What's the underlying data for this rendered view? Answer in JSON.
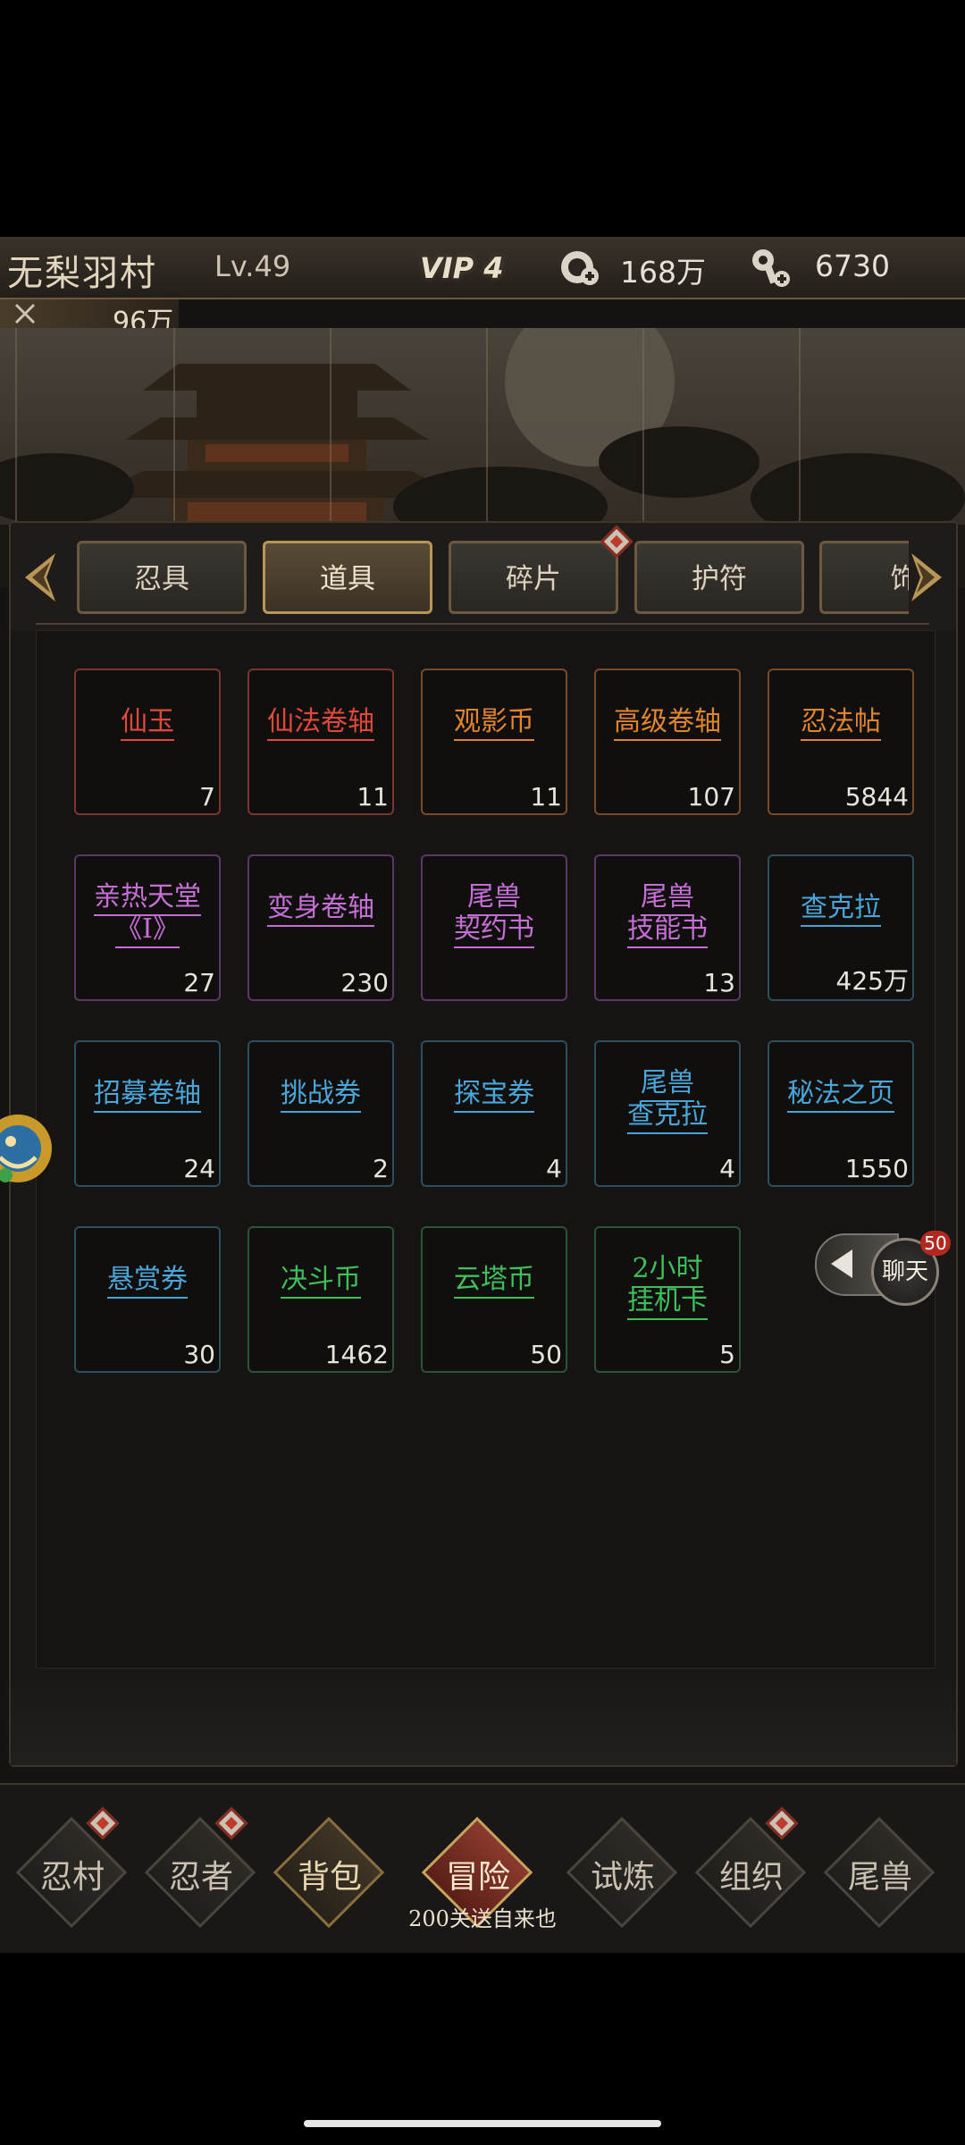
{
  "header": {
    "village_name": "无梨羽村",
    "level": "Lv.49",
    "vip": "VIP 4",
    "resource1_value": "168万",
    "resource2_value": "6730",
    "power_value": "96万"
  },
  "tabs": [
    {
      "label": "忍具"
    },
    {
      "label": "道具"
    },
    {
      "label": "碎片"
    },
    {
      "label": "护符"
    },
    {
      "label": "饰"
    }
  ],
  "active_tab": "道具",
  "items": [
    {
      "name": "仙玉",
      "count": "7",
      "color": "#e0483a"
    },
    {
      "name": "仙法卷轴",
      "count": "11",
      "color": "#e0483a"
    },
    {
      "name": "观影币",
      "count": "11",
      "color": "#e0852e"
    },
    {
      "name": "高级卷轴",
      "count": "107",
      "color": "#e0852e"
    },
    {
      "name": "忍法帖",
      "count": "5844",
      "color": "#e0852e"
    },
    {
      "name": "亲热天堂",
      "name2": "《Ⅰ》",
      "count": "27",
      "color": "#c56fd6"
    },
    {
      "name": "变身卷轴",
      "count": "230",
      "color": "#c56fd6"
    },
    {
      "name": "尾兽",
      "name2": "契约书",
      "count": "",
      "color": "#c56fd6"
    },
    {
      "name": "尾兽",
      "name2": "技能书",
      "count": "13",
      "color": "#c56fd6"
    },
    {
      "name": "查克拉",
      "count": "425万",
      "color": "#4aa6d9"
    },
    {
      "name": "招募卷轴",
      "count": "24",
      "color": "#4aa6d9"
    },
    {
      "name": "挑战券",
      "count": "2",
      "color": "#4aa6d9"
    },
    {
      "name": "探宝券",
      "count": "4",
      "color": "#4aa6d9"
    },
    {
      "name": "尾兽",
      "name2": "查克拉",
      "count": "4",
      "color": "#4aa6d9"
    },
    {
      "name": "秘法之页",
      "count": "1550",
      "color": "#4aa6d9"
    },
    {
      "name": "悬赏券",
      "count": "30",
      "color": "#4aa6d9"
    },
    {
      "name": "决斗币",
      "count": "1462",
      "color": "#3fbf5a"
    },
    {
      "name": "云塔币",
      "count": "50",
      "color": "#3fbf5a"
    },
    {
      "name": "2小时",
      "name2": "挂机卡",
      "count": "5",
      "color": "#3fbf5a"
    }
  ],
  "chat": {
    "label": "聊天",
    "badge": "50"
  },
  "nav": [
    {
      "label": "忍村"
    },
    {
      "label": "忍者"
    },
    {
      "label": "背包"
    },
    {
      "label": "冒险"
    },
    {
      "label": "试炼"
    },
    {
      "label": "组织"
    },
    {
      "label": "尾兽"
    }
  ],
  "nav_sub": "200关送自来也"
}
